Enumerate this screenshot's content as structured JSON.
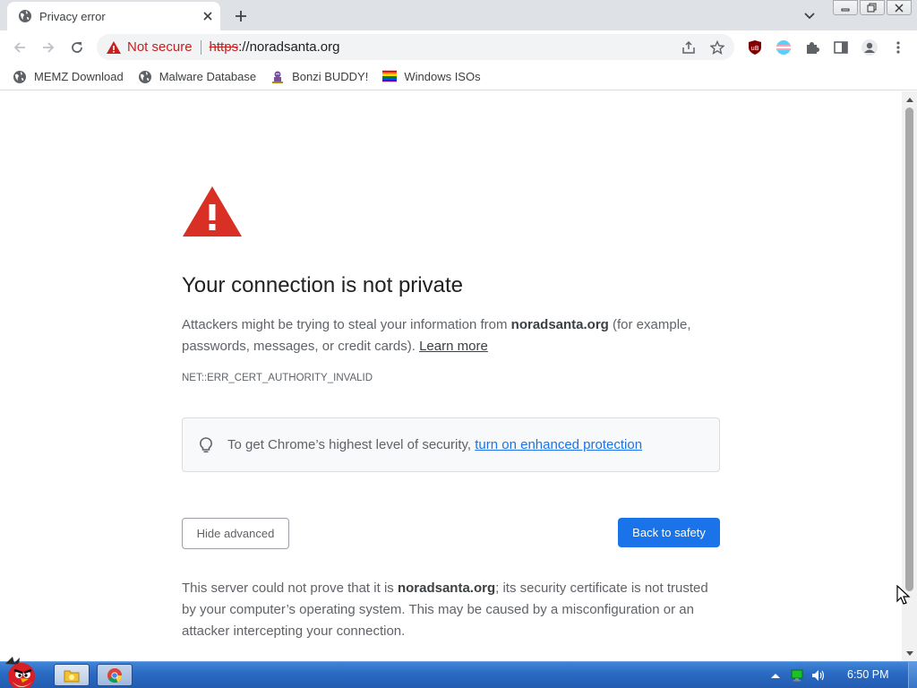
{
  "tab": {
    "title": "Privacy error"
  },
  "toolbar": {
    "security_label": "Not secure",
    "url_scheme": "https",
    "url_rest": "://noradsanta.org"
  },
  "bookmarks": [
    {
      "label": "MEMZ Download",
      "icon": "globe-icon"
    },
    {
      "label": "Malware Database",
      "icon": "globe-icon"
    },
    {
      "label": "Bonzi BUDDY!",
      "icon": "bonzi-icon"
    },
    {
      "label": "Windows ISOs",
      "icon": "rainbow-flag-icon"
    }
  ],
  "page": {
    "heading": "Your connection is not private",
    "desc_before": "Attackers might be trying to steal your information from ",
    "desc_domain": "noradsanta.org",
    "desc_after": " (for example, passwords, messages, or credit cards). ",
    "learn_more": "Learn more",
    "error_code": "NET::ERR_CERT_AUTHORITY_INVALID",
    "enhanced_text": "To get Chrome’s highest level of security, ",
    "enhanced_link": "turn on enhanced protection",
    "hide_advanced": "Hide advanced",
    "back_to_safety": "Back to safety",
    "details_before": "This server could not prove that it is ",
    "details_domain": "noradsanta.org",
    "details_after": "; its security certificate is not trusted by your computer’s operating system. This may be caused by a misconfiguration or an attacker intercepting your connection."
  },
  "taskbar": {
    "clock": "6:50 PM"
  },
  "colors": {
    "warning_red": "#d93025",
    "link_blue": "#1a73e8",
    "button_blue": "#1a73e8"
  }
}
